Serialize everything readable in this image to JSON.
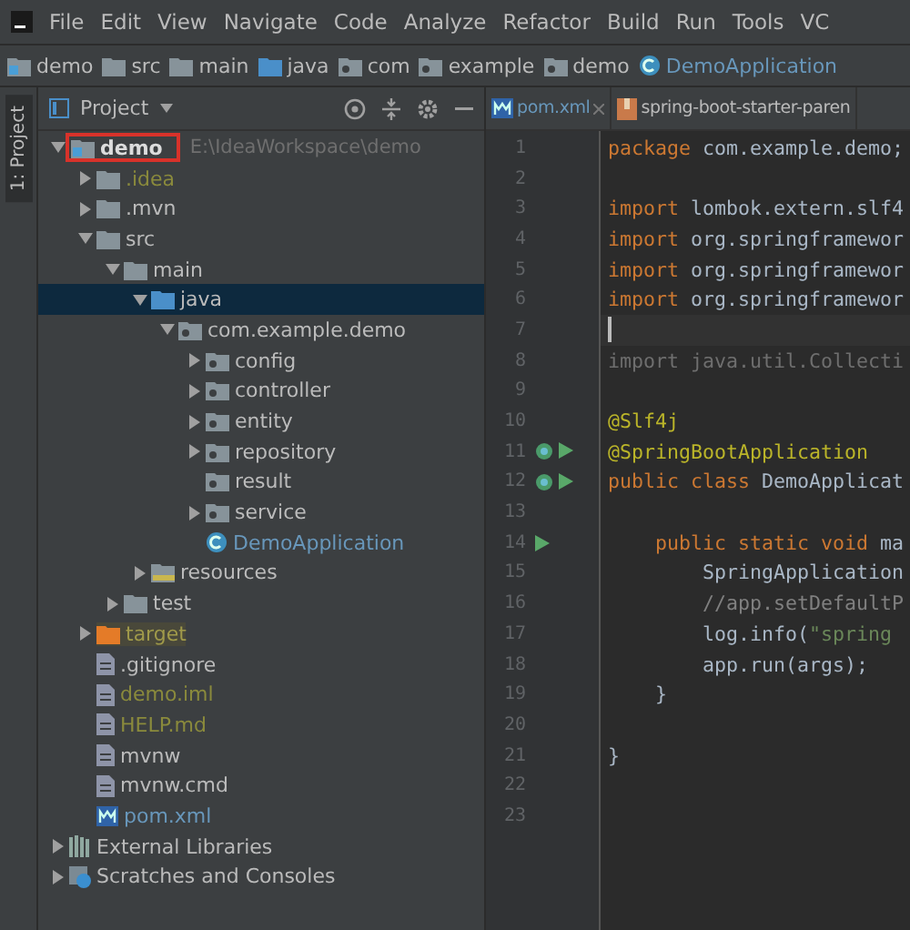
{
  "menu": [
    "File",
    "Edit",
    "View",
    "Navigate",
    "Code",
    "Analyze",
    "Refactor",
    "Build",
    "Run",
    "Tools",
    "VC"
  ],
  "breadcrumbs": [
    {
      "label": "demo",
      "kind": "module"
    },
    {
      "label": "src",
      "kind": "folder"
    },
    {
      "label": "main",
      "kind": "folder"
    },
    {
      "label": "java",
      "kind": "source"
    },
    {
      "label": "com",
      "kind": "package"
    },
    {
      "label": "example",
      "kind": "package"
    },
    {
      "label": "demo",
      "kind": "package"
    },
    {
      "label": "DemoApplication",
      "kind": "class"
    }
  ],
  "side_tab": "1: Project",
  "panel": {
    "title": "Project"
  },
  "editor_tabs": [
    {
      "label": "pom.xml",
      "kind": "maven",
      "closable": true
    },
    {
      "label": "spring-boot-starter-paren",
      "kind": "archive"
    }
  ],
  "tree": [
    {
      "label": "demo",
      "path": "E:\\IdeaWorkspace\\demo",
      "kind": "module",
      "expanded": true,
      "selected": false,
      "boxed": true,
      "children": [
        {
          "label": ".idea",
          "kind": "folder",
          "expanded": false,
          "selected": false,
          "boxed": false,
          "color": "#8a8a3c"
        },
        {
          "label": ".mvn",
          "kind": "folder",
          "expanded": false,
          "selected": false,
          "boxed": false,
          "color": "#bbbbbb"
        },
        {
          "label": "src",
          "kind": "folder",
          "expanded": true,
          "selected": false,
          "boxed": false,
          "color": "#bbbbbb",
          "children": [
            {
              "label": "main",
              "kind": "folder",
              "expanded": true,
              "selected": false,
              "boxed": false,
              "color": "#bbbbbb",
              "children": [
                {
                  "label": "java",
                  "kind": "source",
                  "expanded": true,
                  "selected": true,
                  "boxed": false,
                  "color": "#bbbbbb",
                  "children": [
                    {
                      "label": "com.example.demo",
                      "kind": "package",
                      "expanded": true,
                      "selected": false,
                      "boxed": false,
                      "color": "#bbbbbb",
                      "children": [
                        {
                          "label": "config",
                          "kind": "package",
                          "expanded": false,
                          "selected": false,
                          "boxed": false,
                          "color": "#bbbbbb"
                        },
                        {
                          "label": "controller",
                          "kind": "package",
                          "expanded": false,
                          "selected": false,
                          "boxed": false,
                          "color": "#bbbbbb"
                        },
                        {
                          "label": "entity",
                          "kind": "package",
                          "expanded": false,
                          "selected": false,
                          "boxed": false,
                          "color": "#bbbbbb"
                        },
                        {
                          "label": "repository",
                          "kind": "package",
                          "expanded": false,
                          "selected": false,
                          "boxed": false,
                          "color": "#bbbbbb"
                        },
                        {
                          "label": "result",
                          "kind": "package",
                          "selected": false,
                          "boxed": false,
                          "color": "#bbbbbb"
                        },
                        {
                          "label": "service",
                          "kind": "package",
                          "expanded": false,
                          "selected": false,
                          "boxed": false,
                          "color": "#bbbbbb"
                        },
                        {
                          "label": "DemoApplication",
                          "kind": "class",
                          "selected": false,
                          "boxed": false,
                          "color": "#6897bb"
                        }
                      ]
                    }
                  ]
                },
                {
                  "label": "resources",
                  "kind": "resources",
                  "expanded": false,
                  "selected": false,
                  "boxed": false,
                  "color": "#bbbbbb"
                }
              ]
            },
            {
              "label": "test",
              "kind": "folder",
              "expanded": false,
              "selected": false,
              "boxed": false,
              "color": "#bbbbbb"
            }
          ]
        },
        {
          "label": "target",
          "kind": "excluded",
          "expanded": false,
          "selected": false,
          "boxed": false,
          "color": "#a09a4a"
        },
        {
          "label": ".gitignore",
          "kind": "file",
          "selected": false,
          "boxed": false,
          "color": "#bbbbbb"
        },
        {
          "label": "demo.iml",
          "kind": "file",
          "selected": false,
          "boxed": false,
          "color": "#8a8a3c"
        },
        {
          "label": "HELP.md",
          "kind": "file",
          "selected": false,
          "boxed": false,
          "color": "#8a8a3c"
        },
        {
          "label": "mvnw",
          "kind": "file",
          "selected": false,
          "boxed": false,
          "color": "#bbbbbb"
        },
        {
          "label": "mvnw.cmd",
          "kind": "file",
          "selected": false,
          "boxed": false,
          "color": "#bbbbbb"
        },
        {
          "label": "pom.xml",
          "kind": "maven",
          "selected": false,
          "boxed": false,
          "color": "#6897bb"
        }
      ]
    },
    {
      "label": "External Libraries",
      "kind": "library",
      "expanded": false,
      "selected": false,
      "boxed": false,
      "color": "#bbbbbb"
    },
    {
      "label": "Scratches and Consoles",
      "kind": "scratch",
      "expanded": false,
      "selected": false,
      "boxed": false,
      "color": "#bbbbbb"
    }
  ],
  "code": [
    {
      "number": "1",
      "current": false,
      "segments": [
        {
          "text": "package",
          "kind": "keyword"
        },
        {
          "text": " com.example.demo;",
          "kind": "plain"
        }
      ]
    },
    {
      "number": "2",
      "current": false
    },
    {
      "number": "3",
      "current": false,
      "segments": [
        {
          "text": "import",
          "kind": "keyword"
        },
        {
          "text": " lombok.extern.slf4",
          "kind": "plain"
        }
      ]
    },
    {
      "number": "4",
      "current": false,
      "segments": [
        {
          "text": "import",
          "kind": "keyword"
        },
        {
          "text": " org.springframewor",
          "kind": "plain"
        }
      ]
    },
    {
      "number": "5",
      "current": false,
      "segments": [
        {
          "text": "import",
          "kind": "keyword"
        },
        {
          "text": " org.springframewor",
          "kind": "plain"
        }
      ]
    },
    {
      "number": "6",
      "current": false,
      "segments": [
        {
          "text": "import",
          "kind": "keyword"
        },
        {
          "text": " org.springframewor",
          "kind": "plain"
        }
      ]
    },
    {
      "number": "7",
      "current": true
    },
    {
      "number": "8",
      "current": false,
      "segments": [
        {
          "text": "import java.util.Collecti",
          "kind": "unused"
        }
      ]
    },
    {
      "number": "9",
      "current": false
    },
    {
      "number": "10",
      "current": false,
      "segments": [
        {
          "text": "@Slf4j",
          "kind": "annotation"
        }
      ]
    },
    {
      "number": "11",
      "current": false,
      "gutter_icons": [
        {
          "kind": "bean"
        },
        {
          "kind": "run"
        }
      ],
      "segments": [
        {
          "text": "@SpringBootApplication",
          "kind": "annotation"
        }
      ]
    },
    {
      "number": "12",
      "current": false,
      "gutter_icons": [
        {
          "kind": "bean"
        },
        {
          "kind": "run"
        }
      ],
      "segments": [
        {
          "text": "public class",
          "kind": "keyword"
        },
        {
          "text": " DemoApplicat",
          "kind": "plain"
        }
      ]
    },
    {
      "number": "13",
      "current": false
    },
    {
      "number": "14",
      "current": false,
      "gutter_icons": [
        {
          "kind": "run"
        }
      ],
      "segments": [
        {
          "text": "    public static void",
          "kind": "keyword"
        },
        {
          "text": " ma",
          "kind": "plain"
        }
      ]
    },
    {
      "number": "15",
      "current": false,
      "segments": [
        {
          "text": "        SpringApplication",
          "kind": "plain"
        }
      ]
    },
    {
      "number": "16",
      "current": false,
      "segments": [
        {
          "text": "        //app.setDefaultP",
          "kind": "comment"
        }
      ]
    },
    {
      "number": "17",
      "current": false,
      "segments": [
        {
          "text": "        log.info(",
          "kind": "plain"
        },
        {
          "text": "\"spring",
          "kind": "string"
        }
      ]
    },
    {
      "number": "18",
      "current": false,
      "segments": [
        {
          "text": "        app.run(args);",
          "kind": "plain"
        }
      ]
    },
    {
      "number": "19",
      "current": false,
      "segments": [
        {
          "text": "    }",
          "kind": "plain"
        }
      ]
    },
    {
      "number": "20",
      "current": false
    },
    {
      "number": "21",
      "current": false,
      "segments": [
        {
          "text": "}",
          "kind": "plain"
        }
      ]
    },
    {
      "number": "22",
      "current": false
    },
    {
      "number": "23",
      "current": false
    }
  ]
}
